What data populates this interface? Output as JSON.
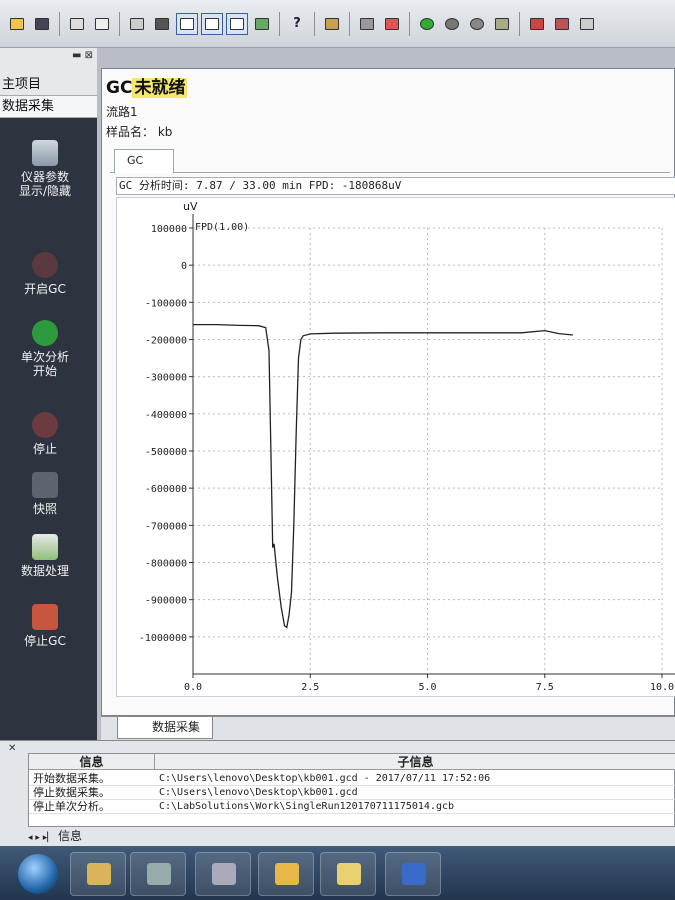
{
  "toolbar": {
    "icons": [
      "open-icon",
      "save-icon",
      "print-icon",
      "print-preview-icon",
      "copy-icon",
      "binoculars-icon",
      "layout1-icon",
      "layout2-icon",
      "layout3-icon",
      "monitor-icon",
      "help-icon",
      "tool-icon",
      "stop-icon",
      "power-icon",
      "start-icon",
      "settings-icon",
      "tune-icon",
      "analyze-icon",
      "report-icon",
      "edit-icon",
      "window-icon"
    ],
    "help_label": "?"
  },
  "left_panel": {
    "header_items": [
      "主项目",
      "数据采集"
    ],
    "buttons": [
      {
        "label_line1": "仪器参数",
        "label_line2": "显示/隐藏",
        "icon": "instrument-icon"
      },
      {
        "label_line1": "开启GC",
        "label_line2": "",
        "icon": "start-gc-icon"
      },
      {
        "label_line1": "单次分析",
        "label_line2": "开始",
        "icon": "single-run-icon"
      },
      {
        "label_line1": "停止",
        "label_line2": "",
        "icon": "stop-icon"
      },
      {
        "label_line1": "快照",
        "label_line2": "",
        "icon": "snapshot-icon"
      },
      {
        "label_line1": "数据处理",
        "label_line2": "",
        "icon": "data-process-icon"
      },
      {
        "label_line1": "停止GC",
        "label_line2": "",
        "icon": "stop-gc-icon"
      }
    ]
  },
  "main": {
    "status_prefix": "GC",
    "status_text": "未就绪",
    "flow_line": "流路1",
    "sample_label": "样品名：",
    "sample_name": "kb",
    "tab_label": "GC",
    "analysis_line": "GC 分析时间: 7.87 / 33.00 min FPD: -180868uV",
    "bottom_tab": "数据采集"
  },
  "chart_data": {
    "type": "line",
    "ylabel": "uV",
    "series_label": "FPD(1.00)",
    "x_ticks": [
      "0.0",
      "2.5",
      "5.0",
      "7.5",
      "10.0"
    ],
    "y_ticks": [
      "100000",
      "0",
      "-100000",
      "-200000",
      "-300000",
      "-400000",
      "-500000",
      "-600000",
      "-700000",
      "-800000",
      "-900000",
      "-1000000"
    ],
    "xlim": [
      0,
      10.0
    ],
    "ylim": [
      -1100000,
      100000
    ],
    "grid": true,
    "series": [
      {
        "x": [
          0.0,
          0.5,
          1.0,
          1.4,
          1.55,
          1.62,
          1.66,
          1.7,
          1.73,
          1.76,
          1.8,
          1.88,
          1.95,
          2.0,
          2.05,
          2.1,
          2.15,
          2.2,
          2.25,
          2.3,
          2.35,
          2.5,
          3.0,
          4.0,
          5.0,
          6.0,
          7.0,
          7.5,
          7.8,
          8.1
        ],
        "y": [
          -160000,
          -160000,
          -162000,
          -163000,
          -168000,
          -230000,
          -500000,
          -760000,
          -750000,
          -790000,
          -840000,
          -920000,
          -970000,
          -975000,
          -940000,
          -880000,
          -700000,
          -450000,
          -250000,
          -200000,
          -190000,
          -185000,
          -183000,
          -182000,
          -182000,
          -182000,
          -182000,
          -176000,
          -184000,
          -188000
        ]
      }
    ]
  },
  "info_panel": {
    "headers": [
      "信息",
      "子信息"
    ],
    "rows": [
      {
        "msg": "开始数据采集。",
        "detail": "C:\\Users\\lenovo\\Desktop\\kb001.gcd - 2017/07/11 17:52:06"
      },
      {
        "msg": "停止数据采集。",
        "detail": "C:\\Users\\lenovo\\Desktop\\kb001.gcd"
      },
      {
        "msg": "停止单次分析。",
        "detail": "C:\\LabSolutions\\Work\\SingleRun120170711175014.gcb"
      }
    ],
    "tab": "信息"
  },
  "taskbar": {
    "apps": [
      "explorer-icon",
      "instrument-app-icon",
      "folder-icon",
      "file-icon",
      "user-icon",
      "word-icon"
    ]
  }
}
